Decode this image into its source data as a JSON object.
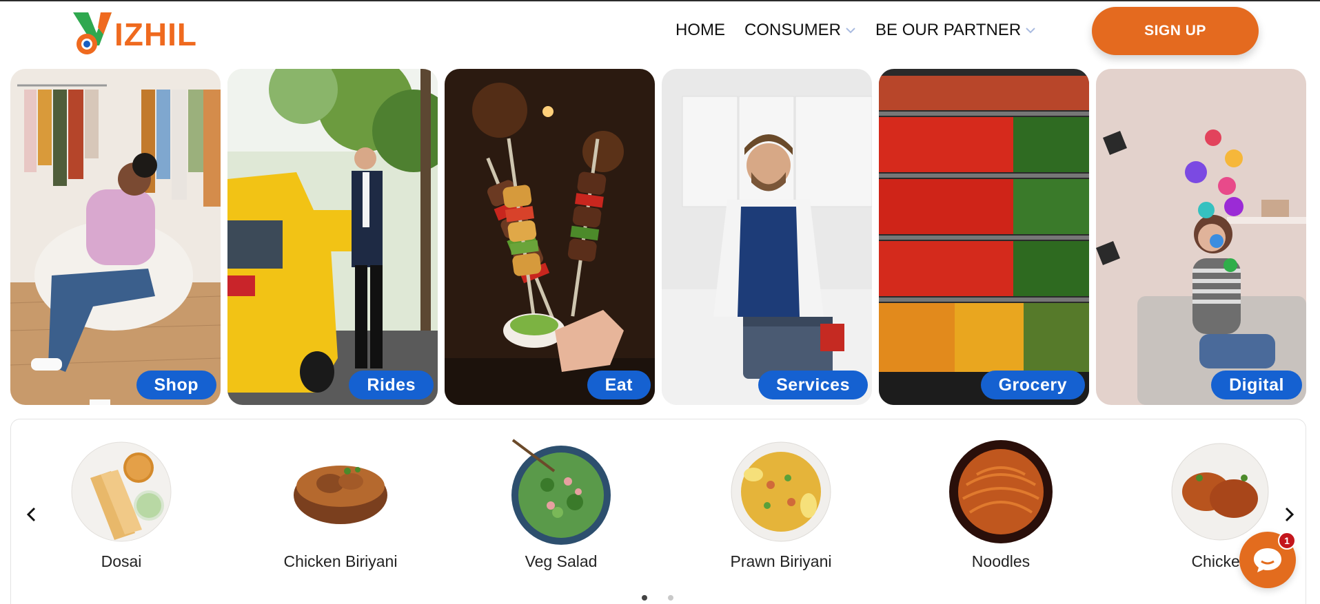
{
  "brand": {
    "logo_text": "IZHIL",
    "accent": "#ef6a1f",
    "logo_green": "#2fa84f",
    "logo_blue": "#1b5fc1"
  },
  "nav": {
    "items": [
      {
        "label": "HOME",
        "has_dropdown": false
      },
      {
        "label": "CONSUMER",
        "has_dropdown": true
      },
      {
        "label": "BE OUR PARTNER",
        "has_dropdown": true
      }
    ],
    "signup_label": "SIGN UP"
  },
  "categories": [
    {
      "label": "Shop",
      "image": "woman-on-chair-in-clothing-store"
    },
    {
      "label": "Rides",
      "image": "man-opening-yellow-taxi"
    },
    {
      "label": "Eat",
      "image": "grilled-kebab-skewers"
    },
    {
      "label": "Services",
      "image": "handyman-with-toolbox"
    },
    {
      "label": "Grocery",
      "image": "vegetable-shelves"
    },
    {
      "label": "Digital",
      "image": "woman-with-phone-and-social-icons"
    }
  ],
  "label_color": "#1561d1",
  "food": {
    "items": [
      {
        "name": "Dosai"
      },
      {
        "name": "Chicken Biriyani"
      },
      {
        "name": "Veg Salad"
      },
      {
        "name": "Prawn Biriyani"
      },
      {
        "name": "Noodles"
      },
      {
        "name": "Chicken"
      }
    ],
    "prev_icon": "chevron-left-icon",
    "next_icon": "chevron-right-icon",
    "page_count": 2,
    "active_page": 1
  },
  "chat": {
    "badge_count": "1",
    "icon": "chat-bubble-icon",
    "color": "#e36c1e"
  }
}
